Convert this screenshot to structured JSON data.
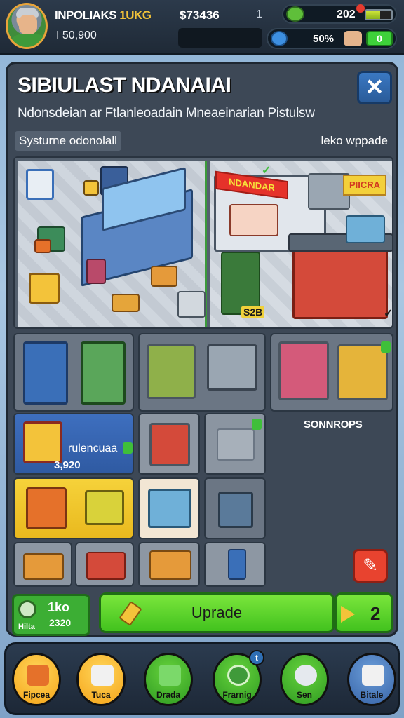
{
  "hud": {
    "player_name_prefix": "INPOLIAKS",
    "player_name_highlight": "1UKG",
    "player_sub": "I 50,900",
    "money": "$73436",
    "money_divider": "1",
    "gems_value": "202",
    "gem_bar_fraction": 0.55,
    "percent_value": "50%",
    "percent_button": "0"
  },
  "panel": {
    "title": "SIBIULAST NDANAIAI",
    "subtitle": "Ndonsdeian ar Ftlanleoadain Mneaeinarian Pistulsw",
    "system_label": "Systurne odonolall",
    "upgrade_label": "leko wppade",
    "close_label": "✕"
  },
  "scene": {
    "shop_sign": "NDANDAR",
    "shop_sign2": "PIICRA",
    "tag": "S2B",
    "flag": "✓"
  },
  "items": {
    "featured_name": "rulencuaa",
    "featured_price": "3,920",
    "sonndrods_label": "SONNROPS"
  },
  "actions": {
    "coin_line1": "1ko",
    "coin_line2": "2320",
    "coin_line3": "Hilta",
    "upgrade_label": "Uprade",
    "next_number": "2"
  },
  "nav": {
    "items": [
      {
        "label": "Fipcea"
      },
      {
        "label": "Tuca"
      },
      {
        "label": "Drada"
      },
      {
        "label": "Frarnig"
      },
      {
        "label": "Sen"
      },
      {
        "label": "Bitale"
      }
    ],
    "badge": "t"
  },
  "colors": {
    "accent_green": "#42c21e",
    "accent_blue": "#2a5b99",
    "accent_yellow": "#f3c33a",
    "panel_bg": "#3d4856"
  }
}
